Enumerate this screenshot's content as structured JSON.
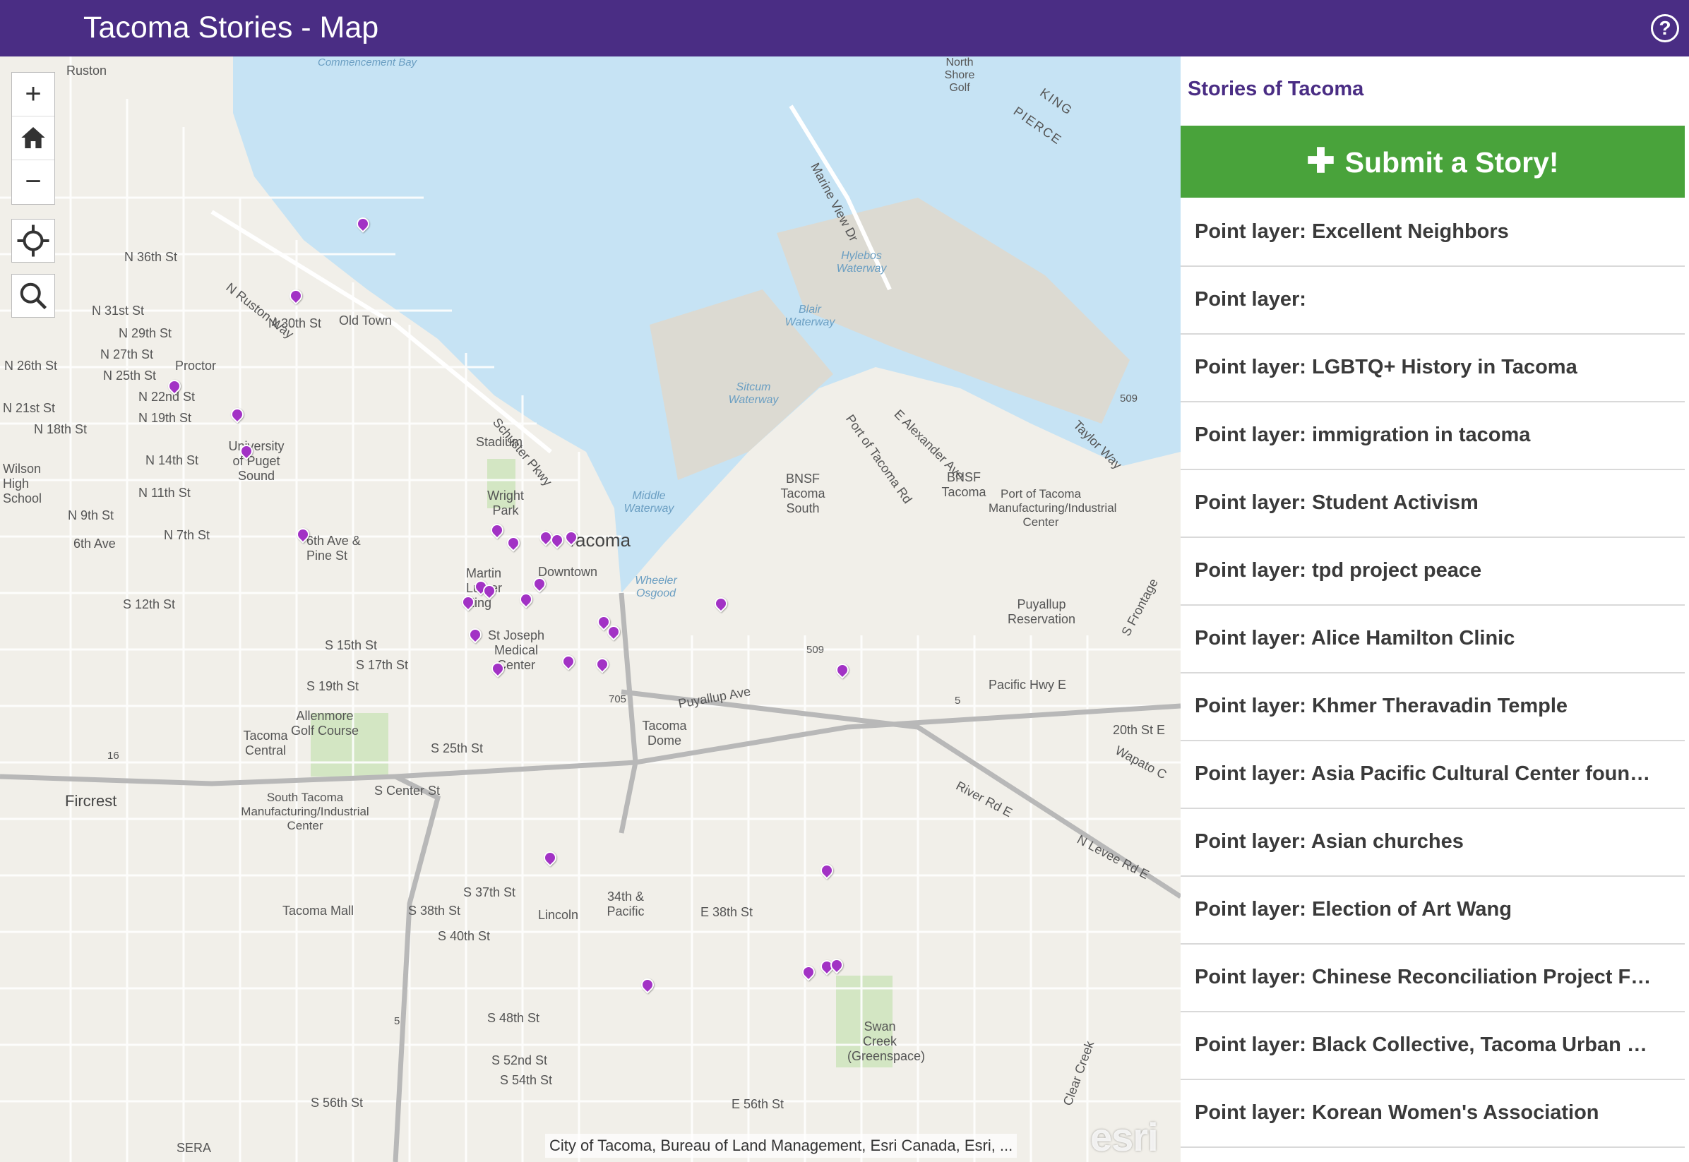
{
  "header": {
    "title": "Tacoma Stories - Map",
    "help_icon": "?"
  },
  "map": {
    "controls": {
      "zoom_in": "+",
      "zoom_out": "−"
    },
    "labels": {
      "ruston": "Ruston",
      "commencement_bay": "Commencement Bay",
      "n_ruston_way": "N Ruston Way",
      "n_36th": "N 36th St",
      "n_31st": "N 31st St",
      "n_30th": "N 30th St",
      "old_town": "Old Town",
      "n_29th": "N 29th St",
      "n_27th": "N 27th St",
      "n_26th": "N 26th St",
      "n_25th": "N 25th St",
      "proctor": "Proctor",
      "n_22nd": "N 22nd St",
      "n_21st": "N 21st St",
      "n_19th": "N 19th St",
      "n_18th": "N 18th St",
      "ups": "University of Puget Sound",
      "n_14th": "N 14th St",
      "n_11th": "N 11th St",
      "n_9th": "N 9th St",
      "n_7th": "N 7th St",
      "sixth_ave": "6th Ave",
      "wilson": "Wilson High School",
      "sixth_pine": "6th Ave & Pine St",
      "schuster": "Schuster Pkwy",
      "stadium": "Stadium",
      "wright_park": "Wright Park",
      "tacoma": "Tacoma",
      "downtown": "Downtown",
      "mlk": "Martin Luther King",
      "st_joseph": "St Joseph Medical Center",
      "s_12th": "S 12th St",
      "s_15th": "S 15th St",
      "s_17th": "S 17th St",
      "s_19th": "S 19th St",
      "s_25th": "S 25th St",
      "allenmore": "Allenmore Golf Course",
      "tacoma_central": "Tacoma Central",
      "fircrest": "Fircrest",
      "south_tacoma": "South Tacoma Manufacturing/Industrial Center",
      "s_center": "S Center St",
      "tacoma_mall": "Tacoma Mall",
      "s_37th": "S 37th St",
      "s_38th": "S 38th St",
      "s_40th": "S 40th St",
      "lincoln": "Lincoln",
      "pacific_34th": "34th & Pacific",
      "e_38th": "E 38th St",
      "s_48th": "S 48th St",
      "s_52nd": "S 52nd St",
      "s_54th": "S 54th St",
      "s_56th": "S 56th St",
      "e_56th": "E 56th St",
      "swan_creek": "Swan Creek (Greenspace)",
      "clear_creek": "Clear Creek",
      "tacoma_dome": "Tacoma Dome",
      "puyallup_ave": "Puyallup Ave",
      "middle_waterway": "Middle Waterway",
      "wheeler_osgood": "Wheeler Osgood",
      "sitcum": "Sitcum Waterway",
      "blair": "Blair Waterway",
      "hylebos": "Hylebos Waterway",
      "bnsf_south": "BNSF Tacoma South",
      "bnsf": "BNSF Tacoma",
      "port_center": "Port of Tacoma Manufacturing/Industrial Center",
      "puyallup_res": "Puyallup Reservation",
      "pacific_hwy": "Pacific Hwy E",
      "river_rd": "River Rd E",
      "n_levee": "N Levee Rd E",
      "e_20th": "20th St E",
      "wapato": "Wapato C",
      "marine_view": "Marine View Dr",
      "e_alexander": "E Alexander Ave",
      "port_of_tacoma_rd": "Port of Tacoma Rd",
      "taylor_way": "Taylor Way",
      "north_shore": "North Shore Golf",
      "king": "KING",
      "pierce": "PIERCE",
      "sr509": "509",
      "i5": "5",
      "i705": "705",
      "sr16": "16",
      "sera": "SERA",
      "frontage": "S Frontage"
    },
    "attribution": "City of Tacoma, Bureau of Land Management, Esri Canada, Esri, ...",
    "logo": "esri",
    "marker_color": "#a232c5"
  },
  "panel": {
    "title": "Stories of Tacoma",
    "submit_label": "Submit a Story!",
    "submit_color": "#49a33b",
    "stories": [
      "Point layer: Excellent Neighbors",
      "Point layer:",
      "Point layer: LGBTQ+ History in Tacoma",
      "Point layer: immigration in tacoma",
      "Point layer: Student Activism",
      "Point layer: tpd project peace",
      "Point layer: Alice Hamilton Clinic",
      "Point layer: Khmer Theravadin Temple",
      "Point layer: Asia Pacific Cultural Center foun…",
      "Point layer: Asian churches",
      "Point layer: Election of Art Wang",
      "Point layer: Chinese Reconciliation Project F…",
      "Point layer: Black Collective, Tacoma Urban …",
      "Point layer: Korean Women's Association"
    ]
  },
  "colors": {
    "header": "#4a2d84",
    "water": "#c6e3f4",
    "land": "#f1efe9"
  }
}
